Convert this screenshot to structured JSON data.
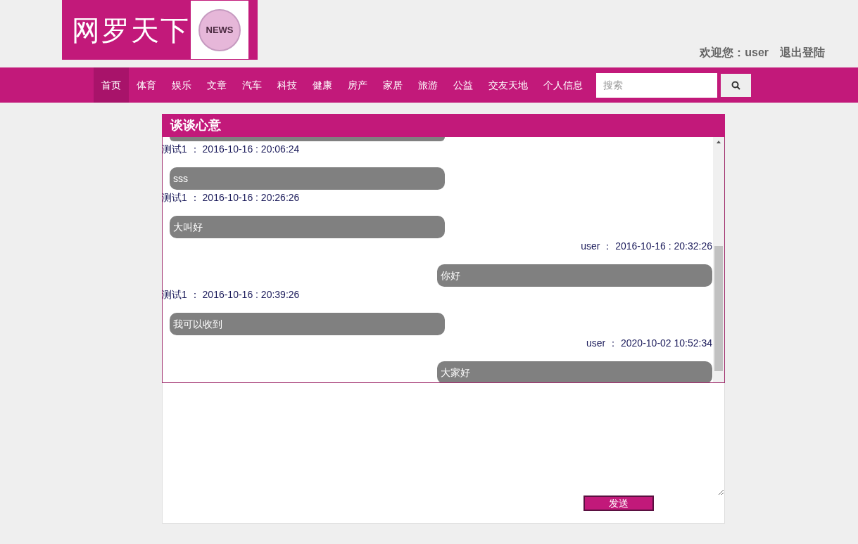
{
  "logo": {
    "title": "网罗天下",
    "badge": "NEWS"
  },
  "user_bar": {
    "welcome": "欢迎您：user",
    "logout": "退出登陆"
  },
  "nav": {
    "items": [
      {
        "label": "首页",
        "selected": true
      },
      {
        "label": "体育",
        "selected": false
      },
      {
        "label": "娱乐",
        "selected": false
      },
      {
        "label": "文章",
        "selected": false
      },
      {
        "label": "汽车",
        "selected": false
      },
      {
        "label": "科技",
        "selected": false
      },
      {
        "label": "健康",
        "selected": false
      },
      {
        "label": "房产",
        "selected": false
      },
      {
        "label": "家居",
        "selected": false
      },
      {
        "label": "旅游",
        "selected": false
      },
      {
        "label": "公益",
        "selected": false
      },
      {
        "label": "交友天地",
        "selected": false
      },
      {
        "label": "个人信息",
        "selected": false
      }
    ],
    "search": {
      "placeholder": "搜索"
    }
  },
  "chat": {
    "title": "谈谈心意",
    "messages": [
      {
        "kind": "incoming",
        "meta": "测试1 ： 2016-10-16 : 20:06:24",
        "text": "sss"
      },
      {
        "kind": "incoming",
        "meta": "测试1 ： 2016-10-16 : 20:26:26",
        "text": "大叫好"
      },
      {
        "kind": "outgoing",
        "meta": "user ： 2016-10-16 : 20:32:26",
        "text": "你好"
      },
      {
        "kind": "incoming",
        "meta": "测试1 ： 2016-10-16 : 20:39:26",
        "text": "我可以收到"
      },
      {
        "kind": "outgoing",
        "meta": "user ： 2020-10-02 10:52:34",
        "text": "大家好"
      }
    ],
    "send": "发送"
  }
}
